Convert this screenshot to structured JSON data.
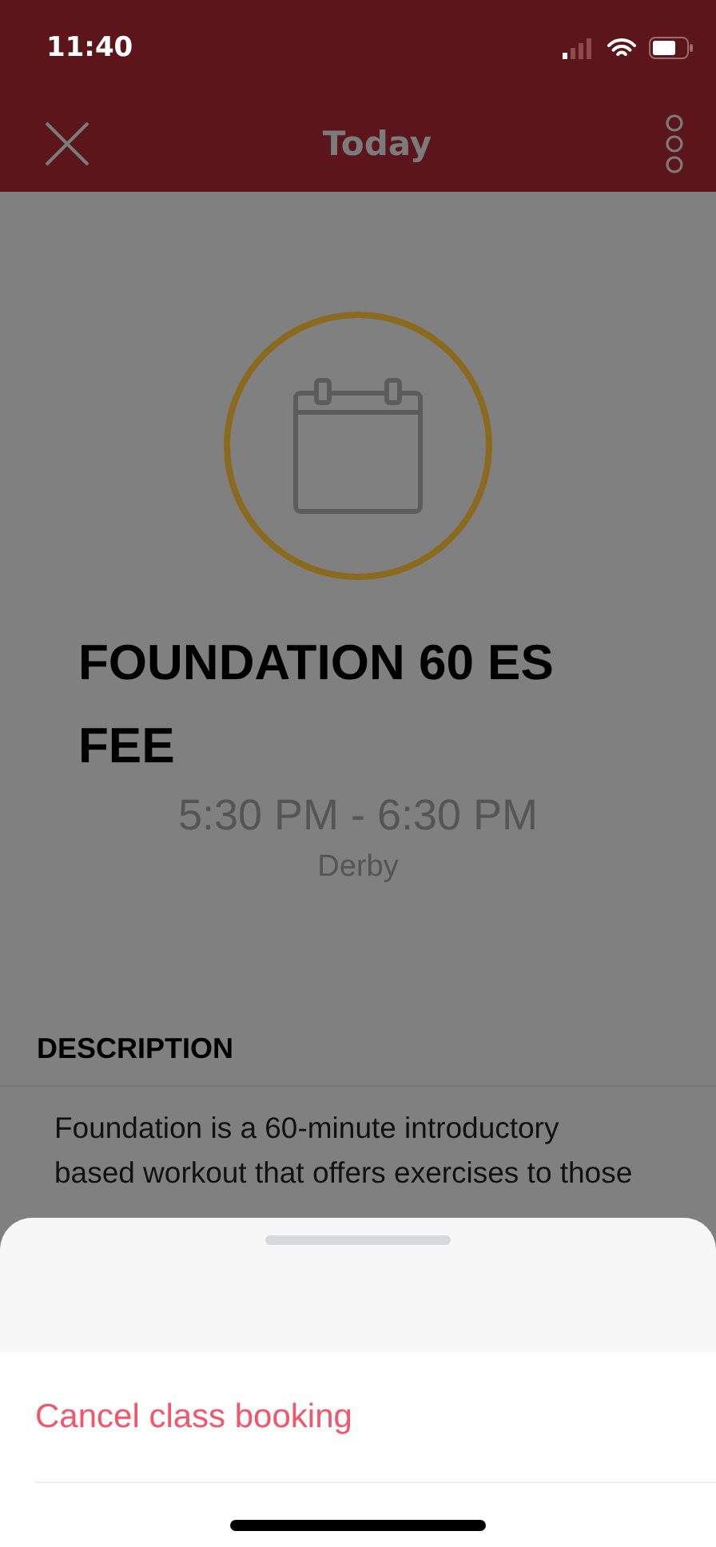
{
  "status_bar": {
    "time": "11:40"
  },
  "header": {
    "title": "Today"
  },
  "class": {
    "name": "FOUNDATION 60 ES FEE",
    "time": "5:30 PM - 6:30 PM",
    "location": "Derby"
  },
  "description": {
    "heading": "DESCRIPTION",
    "lines": [
      "Foundation is a 60-minute introductory",
      "based workout that offers exercises to those"
    ]
  },
  "action_sheet": {
    "actions": [
      {
        "label": "Cancel class booking",
        "kind": "destructive"
      }
    ]
  }
}
